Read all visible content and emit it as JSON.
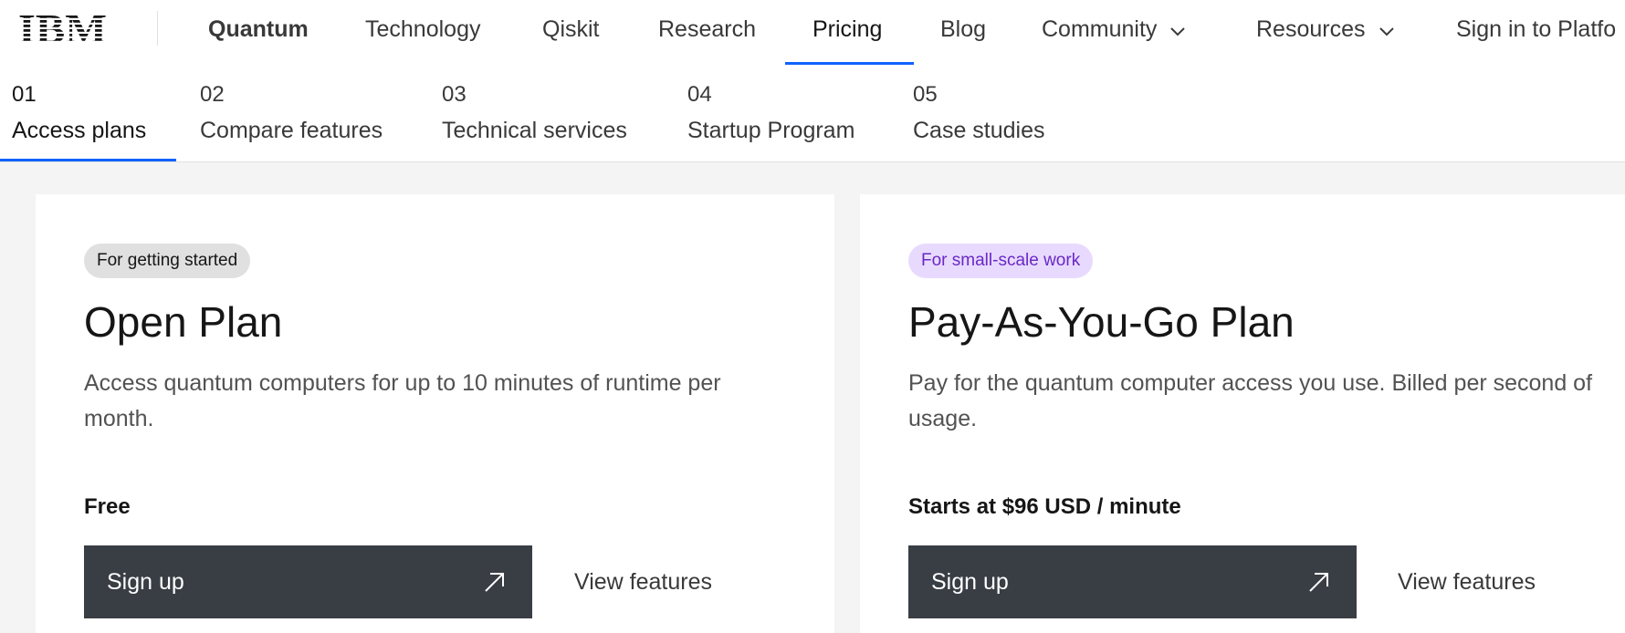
{
  "brand": {
    "logo_text": "IBM",
    "accent": "#0f62fe"
  },
  "nav": {
    "brand_label": "Quantum",
    "items": [
      {
        "label": "Technology"
      },
      {
        "label": "Qiskit"
      },
      {
        "label": "Research"
      },
      {
        "label": "Pricing",
        "active": true
      },
      {
        "label": "Blog"
      },
      {
        "label": "Community",
        "icon": "chevron-down-icon"
      },
      {
        "label": "Resources",
        "icon": "chevron-down-icon"
      },
      {
        "label": "Sign in to Platfo"
      }
    ]
  },
  "subnav": {
    "items": [
      {
        "num": "01",
        "label": "Access plans",
        "active": true
      },
      {
        "num": "02",
        "label": "Compare features"
      },
      {
        "num": "03",
        "label": "Technical services"
      },
      {
        "num": "04",
        "label": "Startup Program"
      },
      {
        "num": "05",
        "label": "Case studies"
      }
    ]
  },
  "plans": [
    {
      "tag": "For getting started",
      "tag_color": "#e0e0e0",
      "title": "Open Plan",
      "description": "Access quantum computers for up to 10 minutes of runtime per month.",
      "price": "Free",
      "signup_label": "Sign up",
      "signup_icon": "arrow-up-right-icon",
      "features_label": "View features"
    },
    {
      "tag": "For small-scale work",
      "tag_color": "#e8daff",
      "title": "Pay-As-You-Go Plan",
      "description": "Pay for the quantum computer access you use. Billed per second of usage.",
      "price": "Starts at $96 USD / minute",
      "signup_label": "Sign up",
      "signup_icon": "arrow-up-right-icon",
      "features_label": "View features"
    }
  ]
}
